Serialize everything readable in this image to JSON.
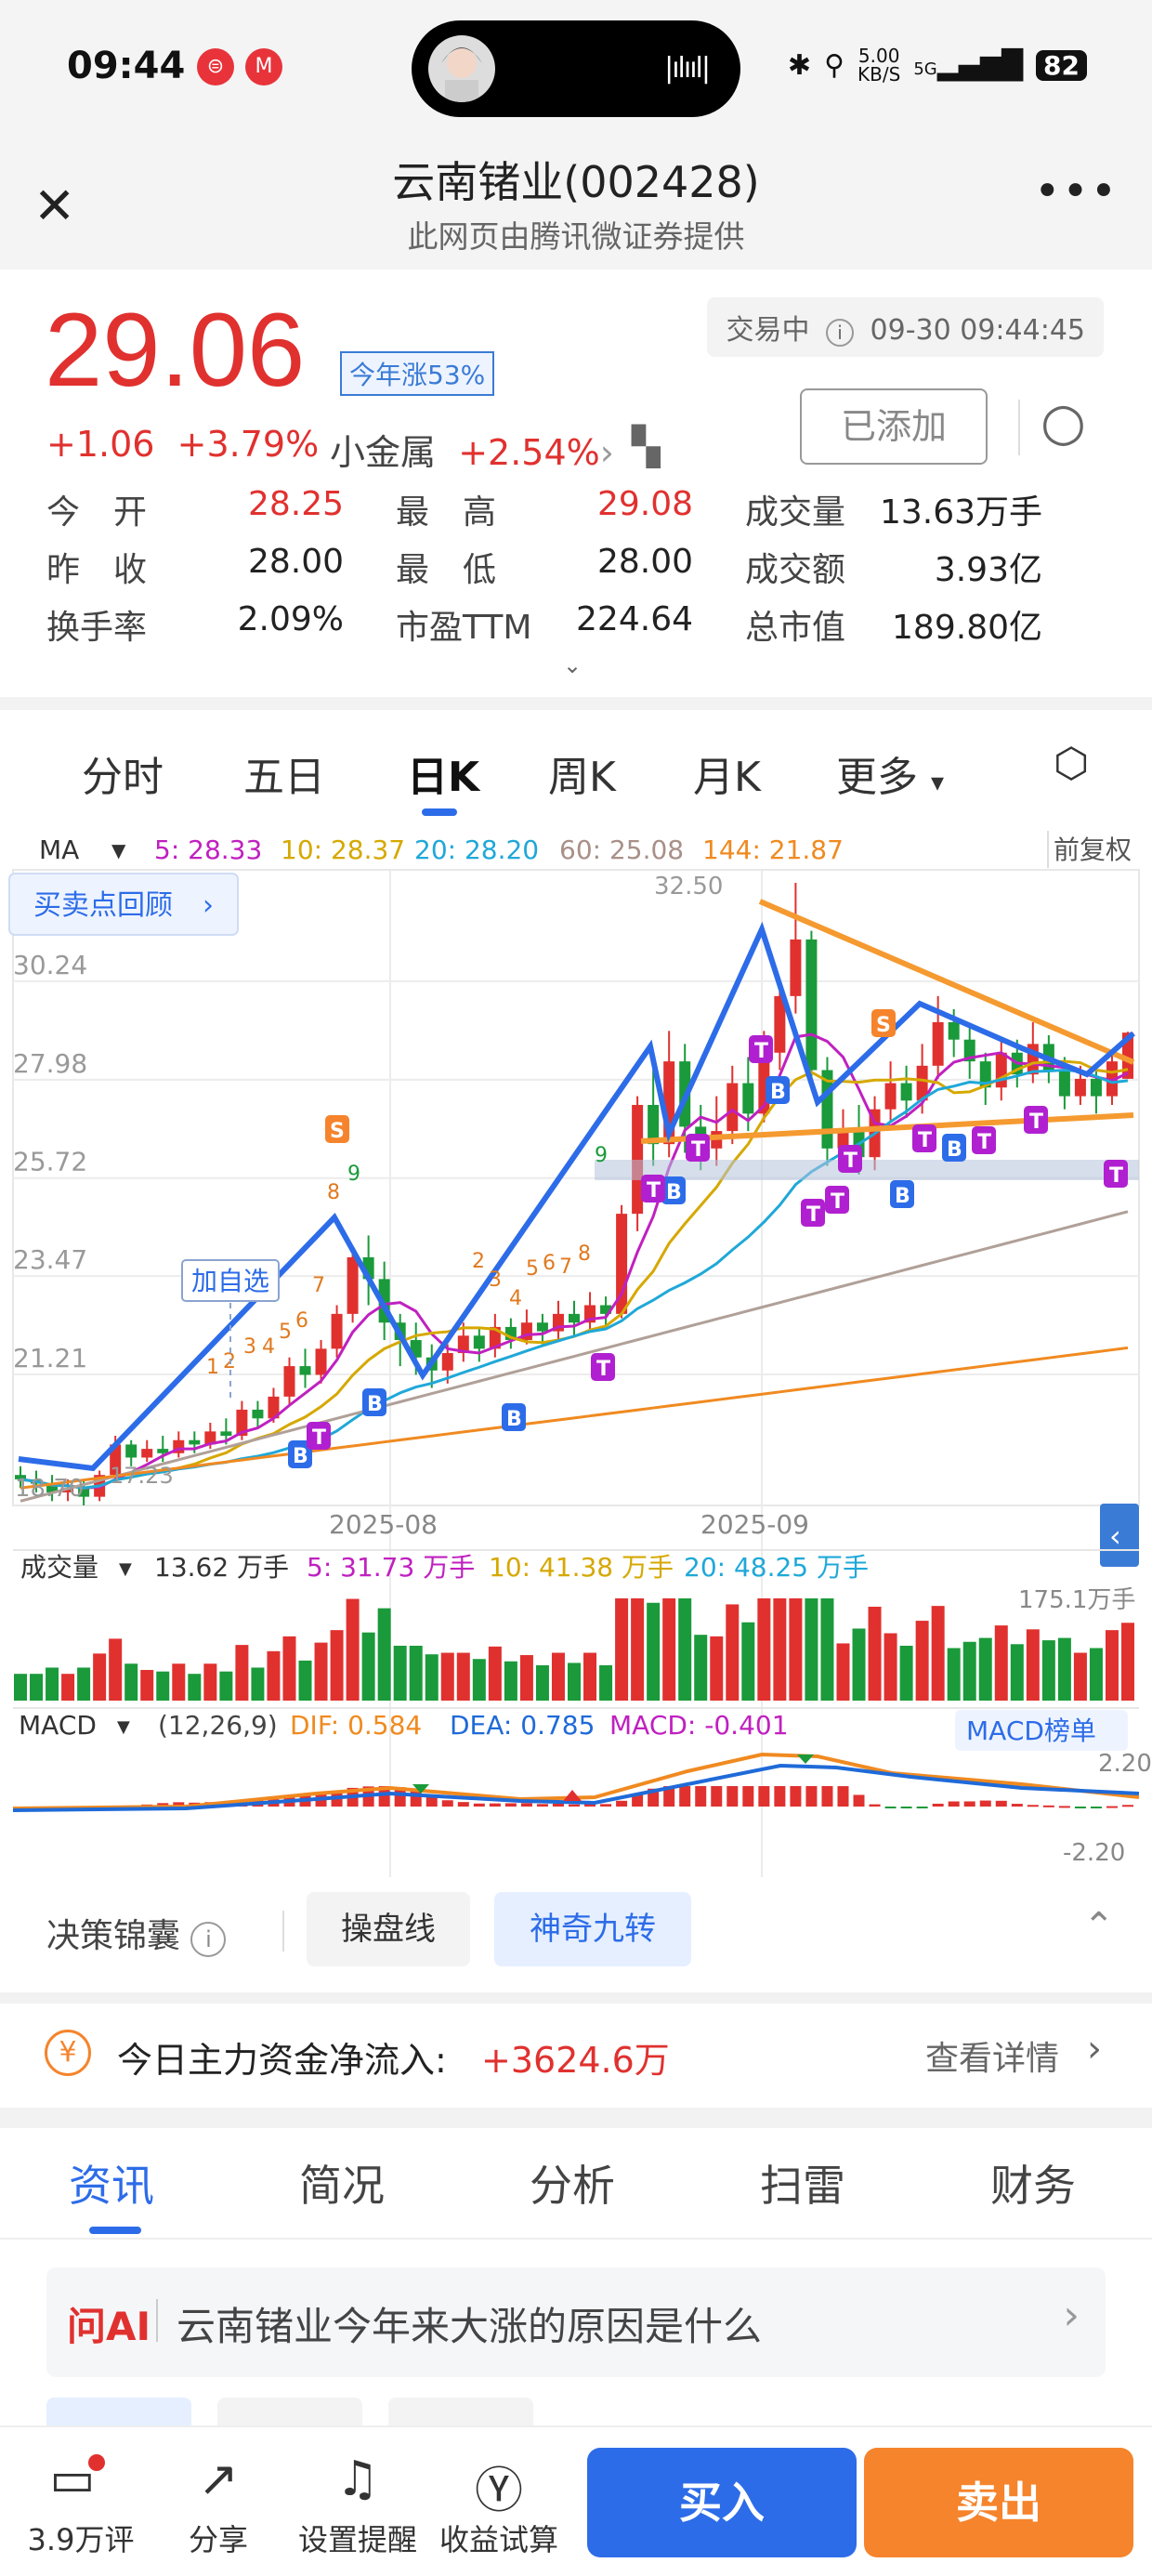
{
  "status_bar": {
    "time": "09:44",
    "net_speed": "5.00",
    "net_unit": "KB/S",
    "signal": "5G",
    "battery": "82"
  },
  "nav": {
    "title": "云南锗业(002428)",
    "subtitle": "此网页由腾讯微证券提供"
  },
  "quote": {
    "price": "29.06",
    "ytd_badge": "今年涨53%",
    "trade_status": "交易中",
    "datetime": "09-30 09:44:45",
    "change": "+1.06",
    "change_pct": "+3.79%",
    "sector_name": "小金属",
    "sector_pct": "+2.54%",
    "added_label": "已添加",
    "stats": [
      {
        "label": "今　开",
        "value": "28.25",
        "color": "#e0312f"
      },
      {
        "label": "最　高",
        "value": "29.08",
        "color": "#e0312f"
      },
      {
        "label": "成交量",
        "value": "13.63万手",
        "color": "#222"
      },
      {
        "label": "昨　收",
        "value": "28.00",
        "color": "#222"
      },
      {
        "label": "最　低",
        "value": "28.00",
        "color": "#222"
      },
      {
        "label": "成交额",
        "value": "3.93亿",
        "color": "#222"
      },
      {
        "label": "换手率",
        "value": "2.09%",
        "color": "#222"
      },
      {
        "label": "市盈TTM",
        "value": "224.64",
        "color": "#222"
      },
      {
        "label": "总市值",
        "value": "189.80亿",
        "color": "#222"
      }
    ]
  },
  "kline_tabs": [
    "分时",
    "五日",
    "日K",
    "周K",
    "月K",
    "更多"
  ],
  "kline_active": "日K",
  "ma_bar": {
    "label": "MA",
    "ma5": "5: 28.33",
    "ma10": "10: 28.37",
    "ma20": "20: 28.20",
    "ma60": "60: 25.08",
    "ma144": "144: 21.87",
    "adjust": "前复权"
  },
  "chart_labels": {
    "buy_sell_review": "买卖点回顾",
    "add_watch": "加自选",
    "high_mark": "32.50",
    "low_mark": "17.23",
    "low_y": "18.70"
  },
  "volume_bar": {
    "label": "成交量",
    "v": "13.62 万手",
    "v5": "5: 31.73 万手",
    "v10": "10: 41.38 万手",
    "v20": "20: 48.25 万手",
    "max": "175.1万手"
  },
  "macd_bar": {
    "label": "MACD",
    "params": "(12,26,9)",
    "dif": "DIF: 0.584",
    "dea": "DEA: 0.785",
    "macd": "MACD: -0.401",
    "rank": "MACD榜单",
    "top": "2.20",
    "bottom": "-2.20"
  },
  "chart_data": {
    "type": "candlestick",
    "x_axis_labels": [
      "2025-08",
      "2025-09"
    ],
    "y_axis_labels": [
      "30.24",
      "27.98",
      "25.72",
      "23.47",
      "21.21"
    ],
    "ylim": [
      18.2,
      32.8
    ],
    "candles": [
      [
        18.9,
        18.8,
        19.1,
        18.6
      ],
      [
        18.8,
        18.7,
        19.0,
        18.5
      ],
      [
        18.7,
        18.5,
        18.9,
        18.3
      ],
      [
        18.5,
        18.6,
        18.8,
        18.3
      ],
      [
        18.6,
        18.4,
        18.8,
        18.2
      ],
      [
        18.4,
        18.9,
        19.0,
        18.3
      ],
      [
        18.9,
        19.6,
        19.8,
        18.8
      ],
      [
        19.6,
        19.3,
        19.7,
        19.1
      ],
      [
        19.3,
        19.5,
        19.7,
        19.2
      ],
      [
        19.5,
        19.4,
        19.8,
        19.2
      ],
      [
        19.4,
        19.7,
        19.9,
        19.3
      ],
      [
        19.7,
        19.6,
        19.9,
        19.4
      ],
      [
        19.6,
        19.9,
        20.1,
        19.5
      ],
      [
        19.9,
        19.8,
        20.2,
        19.6
      ],
      [
        19.8,
        20.4,
        20.6,
        19.7
      ],
      [
        20.4,
        20.2,
        20.6,
        20.0
      ],
      [
        20.2,
        20.7,
        20.9,
        20.1
      ],
      [
        20.7,
        21.4,
        21.6,
        20.5
      ],
      [
        21.4,
        21.2,
        21.8,
        20.9
      ],
      [
        21.2,
        21.8,
        22.0,
        21.0
      ],
      [
        21.8,
        22.6,
        22.8,
        21.6
      ],
      [
        22.6,
        23.9,
        24.1,
        22.4
      ],
      [
        23.9,
        23.4,
        24.4,
        22.8
      ],
      [
        23.4,
        22.4,
        23.8,
        22.0
      ],
      [
        22.4,
        22.0,
        22.6,
        21.4
      ],
      [
        22.0,
        21.6,
        22.4,
        21.2
      ],
      [
        21.6,
        21.3,
        21.9,
        20.9
      ],
      [
        21.3,
        21.7,
        21.9,
        21.0
      ],
      [
        21.7,
        22.1,
        22.4,
        21.5
      ],
      [
        22.1,
        21.8,
        22.3,
        21.5
      ],
      [
        21.8,
        22.3,
        22.6,
        21.6
      ],
      [
        22.3,
        22.0,
        22.5,
        21.8
      ],
      [
        22.0,
        22.4,
        22.7,
        21.9
      ],
      [
        22.4,
        22.2,
        22.6,
        21.9
      ],
      [
        22.2,
        22.6,
        22.9,
        22.0
      ],
      [
        22.6,
        22.4,
        22.9,
        22.1
      ],
      [
        22.4,
        22.8,
        23.1,
        22.2
      ],
      [
        22.8,
        22.6,
        23.0,
        22.3
      ],
      [
        22.6,
        24.9,
        25.1,
        22.5
      ],
      [
        24.9,
        27.4,
        27.6,
        24.5
      ],
      [
        27.4,
        26.5,
        28.2,
        26.0
      ],
      [
        26.5,
        28.4,
        29.1,
        26.2
      ],
      [
        28.4,
        26.9,
        28.8,
        26.3
      ],
      [
        26.9,
        26.4,
        27.4,
        25.9
      ],
      [
        26.4,
        26.8,
        27.6,
        26.0
      ],
      [
        26.8,
        27.9,
        28.3,
        26.5
      ],
      [
        27.9,
        27.2,
        28.5,
        26.8
      ],
      [
        27.2,
        28.6,
        29.1,
        27.0
      ],
      [
        28.6,
        29.9,
        30.2,
        28.2
      ],
      [
        29.9,
        31.2,
        32.5,
        29.5
      ],
      [
        31.2,
        28.2,
        31.4,
        27.8
      ],
      [
        28.2,
        26.4,
        28.5,
        26.0
      ],
      [
        26.4,
        26.8,
        27.3,
        26.0
      ],
      [
        26.8,
        26.2,
        27.4,
        25.8
      ],
      [
        26.2,
        27.3,
        27.6,
        25.9
      ],
      [
        27.3,
        27.9,
        28.4,
        27.0
      ],
      [
        27.9,
        27.5,
        28.3,
        27.1
      ],
      [
        27.5,
        28.3,
        28.8,
        27.2
      ],
      [
        28.3,
        29.3,
        29.9,
        28.0
      ],
      [
        29.3,
        28.9,
        29.6,
        28.5
      ],
      [
        28.9,
        28.4,
        29.2,
        28.0
      ],
      [
        28.4,
        27.8,
        28.6,
        27.4
      ],
      [
        27.8,
        28.6,
        28.9,
        27.5
      ],
      [
        28.6,
        28.1,
        28.9,
        27.8
      ],
      [
        28.1,
        28.8,
        29.3,
        27.9
      ],
      [
        28.8,
        28.2,
        29.0,
        27.9
      ],
      [
        28.2,
        27.6,
        28.5,
        27.3
      ],
      [
        27.6,
        28.0,
        28.3,
        27.4
      ],
      [
        28.0,
        27.6,
        28.3,
        27.2
      ],
      [
        27.6,
        28.4,
        28.6,
        27.4
      ],
      [
        28.0,
        29.06,
        29.08,
        28.0
      ]
    ]
  },
  "decision": {
    "label": "决策锦囊",
    "btn1": "操盘线",
    "btn2": "神奇九转"
  },
  "flow": {
    "label": "今日主力资金净流入:",
    "value": "+3624.6万",
    "detail": "查看详情"
  },
  "news_tabs": [
    "资讯",
    "简况",
    "分析",
    "扫雷",
    "财务"
  ],
  "ask_ai": {
    "tag": "问AI",
    "question": "云南锗业今年来大涨的原因是什么"
  },
  "bottom_bar": {
    "comments": "3.9万评",
    "share": "分享",
    "alert": "设置提醒",
    "calc": "收益试算",
    "buy": "买入",
    "sell": "卖出"
  }
}
